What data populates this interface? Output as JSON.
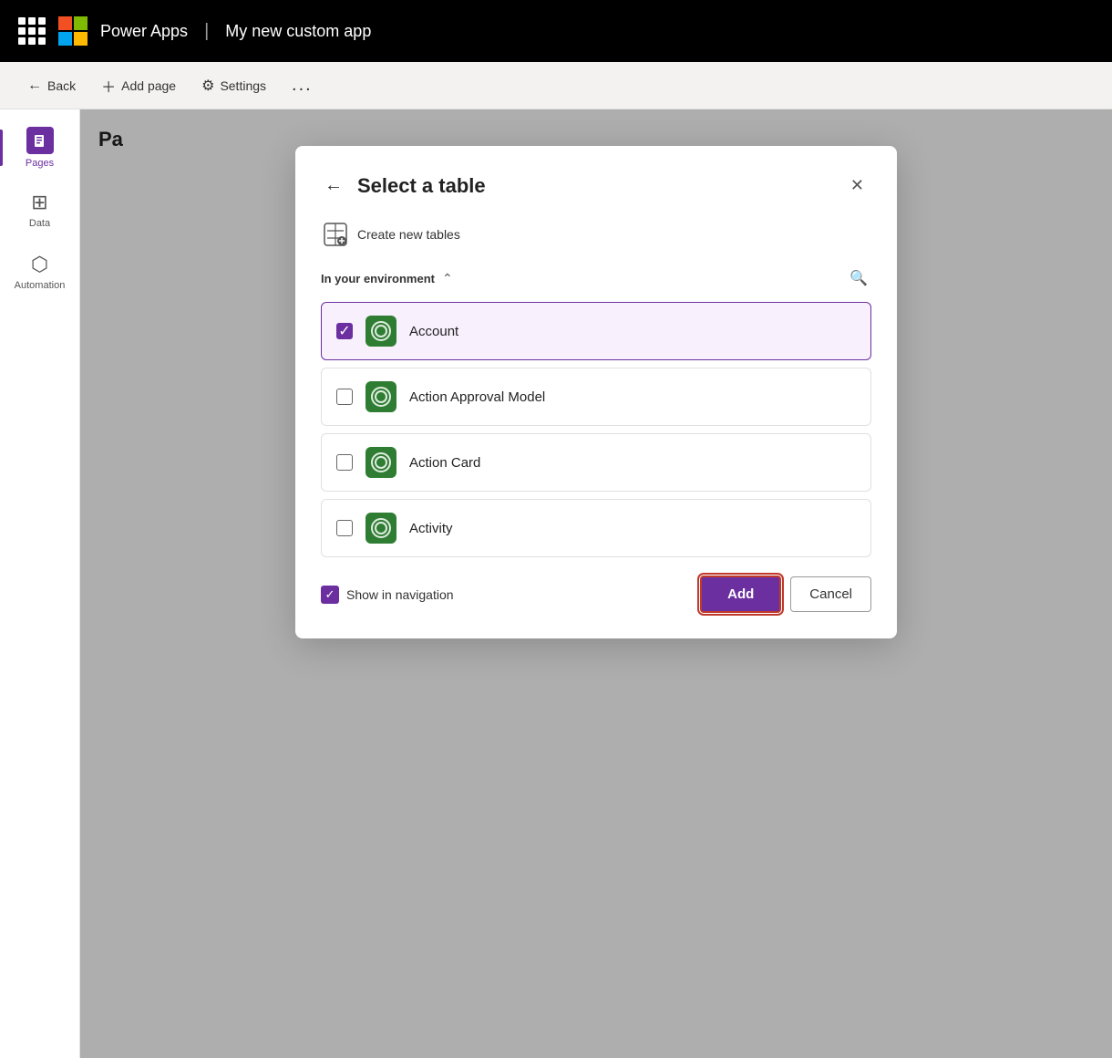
{
  "topbar": {
    "brand": "Power Apps",
    "separator": "|",
    "app_name": "My new custom app"
  },
  "toolbar": {
    "back_label": "Back",
    "add_page_label": "Add page",
    "settings_label": "Settings",
    "more_label": "..."
  },
  "sidebar": {
    "items": [
      {
        "id": "pages",
        "label": "Pages",
        "active": true
      },
      {
        "id": "data",
        "label": "Data",
        "active": false
      },
      {
        "id": "automation",
        "label": "Automation",
        "active": false
      }
    ]
  },
  "content": {
    "title_prefix": "Pa"
  },
  "dialog": {
    "title": "Select a table",
    "create_tables_label": "Create new tables",
    "env_label": "In your environment",
    "tables": [
      {
        "id": "account",
        "name": "Account",
        "selected": true
      },
      {
        "id": "action-approval-model",
        "name": "Action Approval Model",
        "selected": false
      },
      {
        "id": "action-card",
        "name": "Action Card",
        "selected": false
      },
      {
        "id": "activity",
        "name": "Activity",
        "selected": false
      }
    ],
    "show_in_navigation_label": "Show in navigation",
    "show_in_navigation_checked": true,
    "add_label": "Add",
    "cancel_label": "Cancel"
  }
}
